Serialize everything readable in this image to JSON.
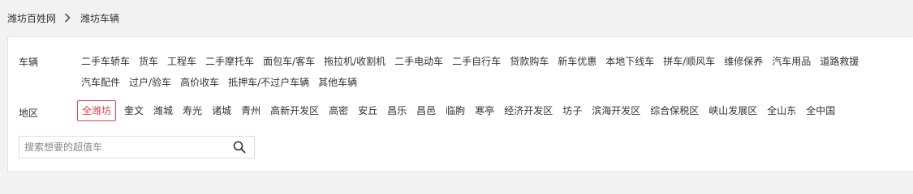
{
  "breadcrumb": {
    "items": [
      "潍坊百姓网",
      "潍坊车辆"
    ]
  },
  "filters": {
    "vehicle": {
      "label": "车辆",
      "options": [
        "二手车轿车",
        "货车",
        "工程车",
        "二手摩托车",
        "面包车/客车",
        "拖拉机/收割机",
        "二手电动车",
        "二手自行车",
        "贷款购车",
        "新车优惠",
        "本地下线车",
        "拼车/顺风车",
        "维修保养",
        "汽车用品",
        "道路救援",
        "汽车配件",
        "过户/验车",
        "高价收车",
        "抵押车/不过户车辆",
        "其他车辆"
      ]
    },
    "region": {
      "label": "地区",
      "selected": "全潍坊",
      "options": [
        "全潍坊",
        "奎文",
        "潍城",
        "寿光",
        "诸城",
        "青州",
        "高新开发区",
        "高密",
        "安丘",
        "昌乐",
        "昌邑",
        "临朐",
        "寒亭",
        "经济开发区",
        "坊子",
        "滨海开发区",
        "综合保税区",
        "峡山发展区",
        "全山东",
        "全中国"
      ]
    }
  },
  "search": {
    "placeholder": "搜索想要的超值车",
    "value": "",
    "icon": "search-icon"
  },
  "colors": {
    "accent": "#e2424b",
    "background": "#f2f2f2",
    "panel": "#ffffff"
  }
}
